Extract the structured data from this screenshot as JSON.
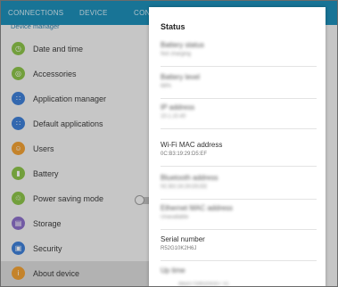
{
  "tabs": [
    "CONNECTIONS",
    "DEVICE",
    "CONTROLS"
  ],
  "section_title": "Device manager",
  "settings_items": [
    {
      "label": "Date and time",
      "icon": "clock-icon",
      "color": "#8bc34a",
      "glyph": "◷"
    },
    {
      "label": "Accessories",
      "icon": "accessories-icon",
      "color": "#8bc34a",
      "glyph": "◎"
    },
    {
      "label": "Application manager",
      "icon": "apps-grid-icon",
      "color": "#3f7fd6",
      "glyph": "∷"
    },
    {
      "label": "Default applications",
      "icon": "default-apps-icon",
      "color": "#3f7fd6",
      "glyph": "∷"
    },
    {
      "label": "Users",
      "icon": "users-icon",
      "color": "#f0a035",
      "glyph": "☺"
    },
    {
      "label": "Battery",
      "icon": "battery-icon",
      "color": "#8bc34a",
      "glyph": "▮"
    },
    {
      "label": "Power saving mode",
      "icon": "power-saving-icon",
      "color": "#8bc34a",
      "glyph": "♲"
    },
    {
      "label": "Storage",
      "icon": "storage-icon",
      "color": "#8b6fc8",
      "glyph": "▤"
    },
    {
      "label": "Security",
      "icon": "security-lock-icon",
      "color": "#3f7fd6",
      "glyph": "▣"
    },
    {
      "label": "About device",
      "icon": "info-icon",
      "color": "#f0a035",
      "glyph": "i"
    }
  ],
  "dialog": {
    "title": "Status",
    "items": [
      {
        "title": "Battery status",
        "value": "Not charging",
        "blurred": true
      },
      {
        "title": "Battery level",
        "value": "68%",
        "blurred": true
      },
      {
        "title": "IP address",
        "value": "10.1.10.40",
        "blurred": true
      },
      {
        "title": "Wi-Fi MAC address",
        "value": "0C:B3:19:29:D5:EF",
        "blurred": false
      },
      {
        "title": "Bluetooth address",
        "value": "0C:B3:19:29:D5:EE",
        "blurred": true
      },
      {
        "title": "Ethernet MAC address",
        "value": "Unavailable",
        "blurred": true
      },
      {
        "title": "Serial number",
        "value": "R52G10K2H6J",
        "blurred": false
      },
      {
        "title": "Up time",
        "value": "",
        "blurred": true
      }
    ]
  },
  "footer_partial": "dwu07SWD04307 #1",
  "colors": {
    "topbar": "#1e8eb8",
    "section": "#2f7fa8"
  }
}
